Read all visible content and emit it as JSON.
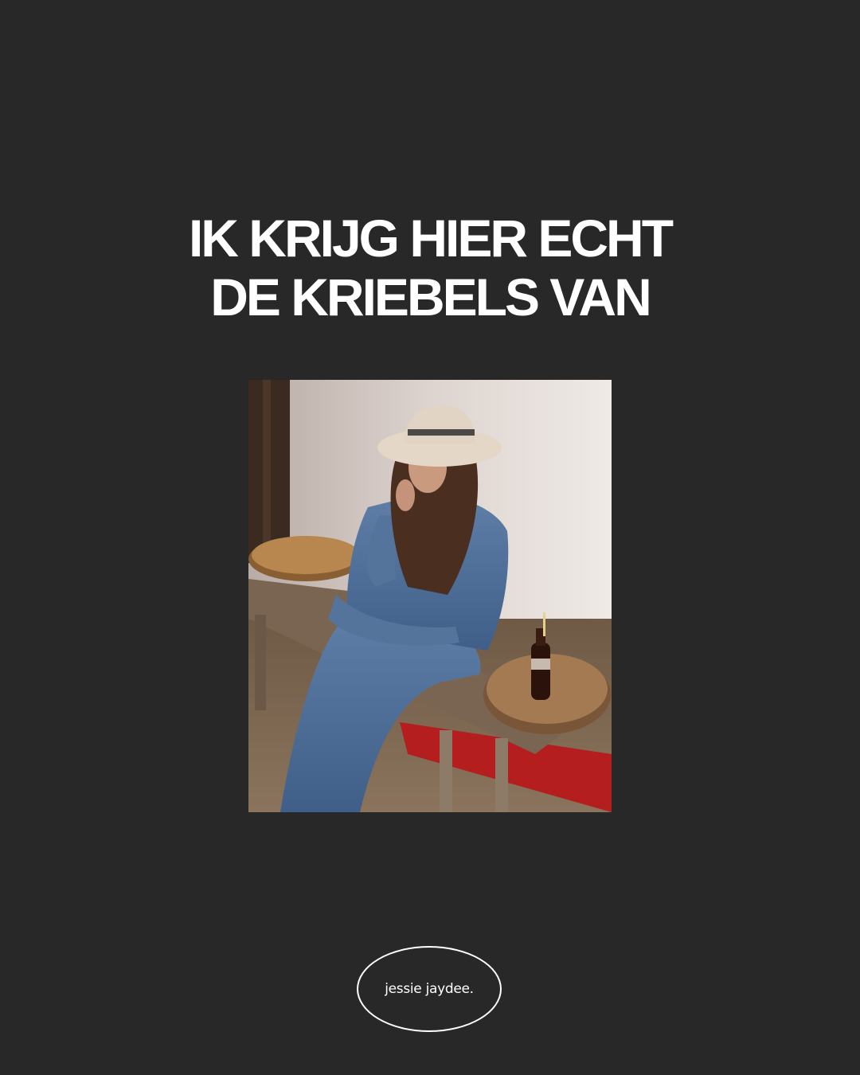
{
  "headline": {
    "line1": "IK KRIJG HIER ECHT",
    "line2": "DE KRIEBELS VAN"
  },
  "logo": {
    "text": "jessie jaydee."
  },
  "colors": {
    "background": "#282828",
    "text": "#ffffff"
  }
}
